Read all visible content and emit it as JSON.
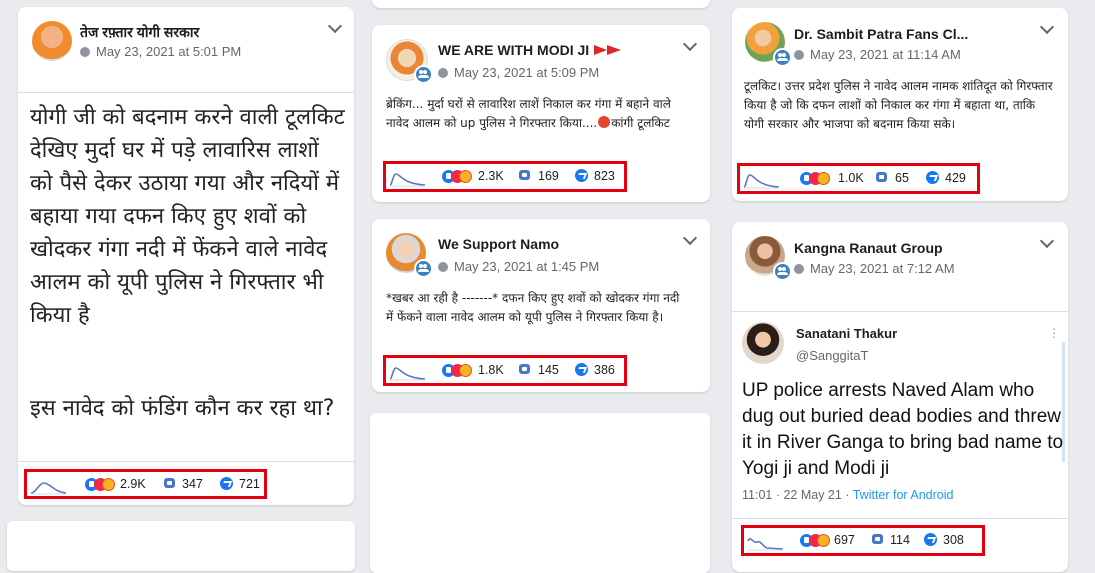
{
  "posts": [
    {
      "page": "तेज रफ़्तार योगी सरकार",
      "date": "May 23, 2021 at 5:01 PM",
      "body": "योगी जी को बदनाम करने वाली टूलकिट देखिए मुर्दा घर में पड़े लावारिस लाशों को पैसे देकर उठाया गया और नदियों में बहाया गया दफन किए हुए शवों को खोदकर गंगा नदी में फेंकने वाले नावेद आलम को यूपी पुलिस ने गिरफ्तार भी किया है",
      "body2": "इस नावेद को फंडिंग कौन कर रहा था?",
      "reactions": "2.9K",
      "comments": "347",
      "shares": "721"
    },
    {
      "page": "WE ARE WITH MODI JI",
      "date": "May 23, 2021 at 5:09 PM",
      "body": "ब्रेकिंग... मुर्दा घरों से लावारिश लाशें निकाल कर गंगा में बहाने वाले नावेद आलम को up पुलिस ने गिरफ्तार किया....",
      "body_suffix": "कांगी टूलकिट",
      "reactions": "2.3K",
      "comments": "169",
      "shares": "823"
    },
    {
      "page": "We Support Namo",
      "date": "May 23, 2021 at 1:45 PM",
      "body": "*खबर आ रही है -------* दफन किए हुए शवों को खोदकर गंगा नदी में फेंकने वाला नावेद आलम को यूपी पुलिस ने गिरफ्तार किया है।",
      "reactions": "1.8K",
      "comments": "145",
      "shares": "386"
    },
    {
      "page": "Dr. Sambit Patra Fans Cl...",
      "date": "May 23, 2021 at 11:14 AM",
      "body": "टूलकिट। उत्तर प्रदेश पुलिस ने नावेद आलम नामक शांतिदूत को गिरफ्तार किया है जो कि दफन लाशों को निकाल कर गंगा में बहाता था, ताकि योगी सरकार और भाजपा को बदनाम किया सके।",
      "reactions": "1.0K",
      "comments": "65",
      "shares": "429"
    },
    {
      "page": "Kangna Ranaut Group",
      "date": "May 23, 2021 at 7:12 AM",
      "reactions": "697",
      "comments": "114",
      "shares": "308",
      "tweet": {
        "name": "Sanatani Thakur",
        "handle": "@SanggitaT",
        "text": "UP police arrests Naved Alam who dug out buried dead bodies and threw it in River Ganga to bring bad name to Yogi ji and Modi ji",
        "time": "11:01 · 22 May 21 · ",
        "source": "Twitter for Android"
      }
    }
  ],
  "colors": {
    "highlight": "#e3000f",
    "facebook_blue": "#1877f2",
    "twitter_blue": "#1d9bf0"
  }
}
